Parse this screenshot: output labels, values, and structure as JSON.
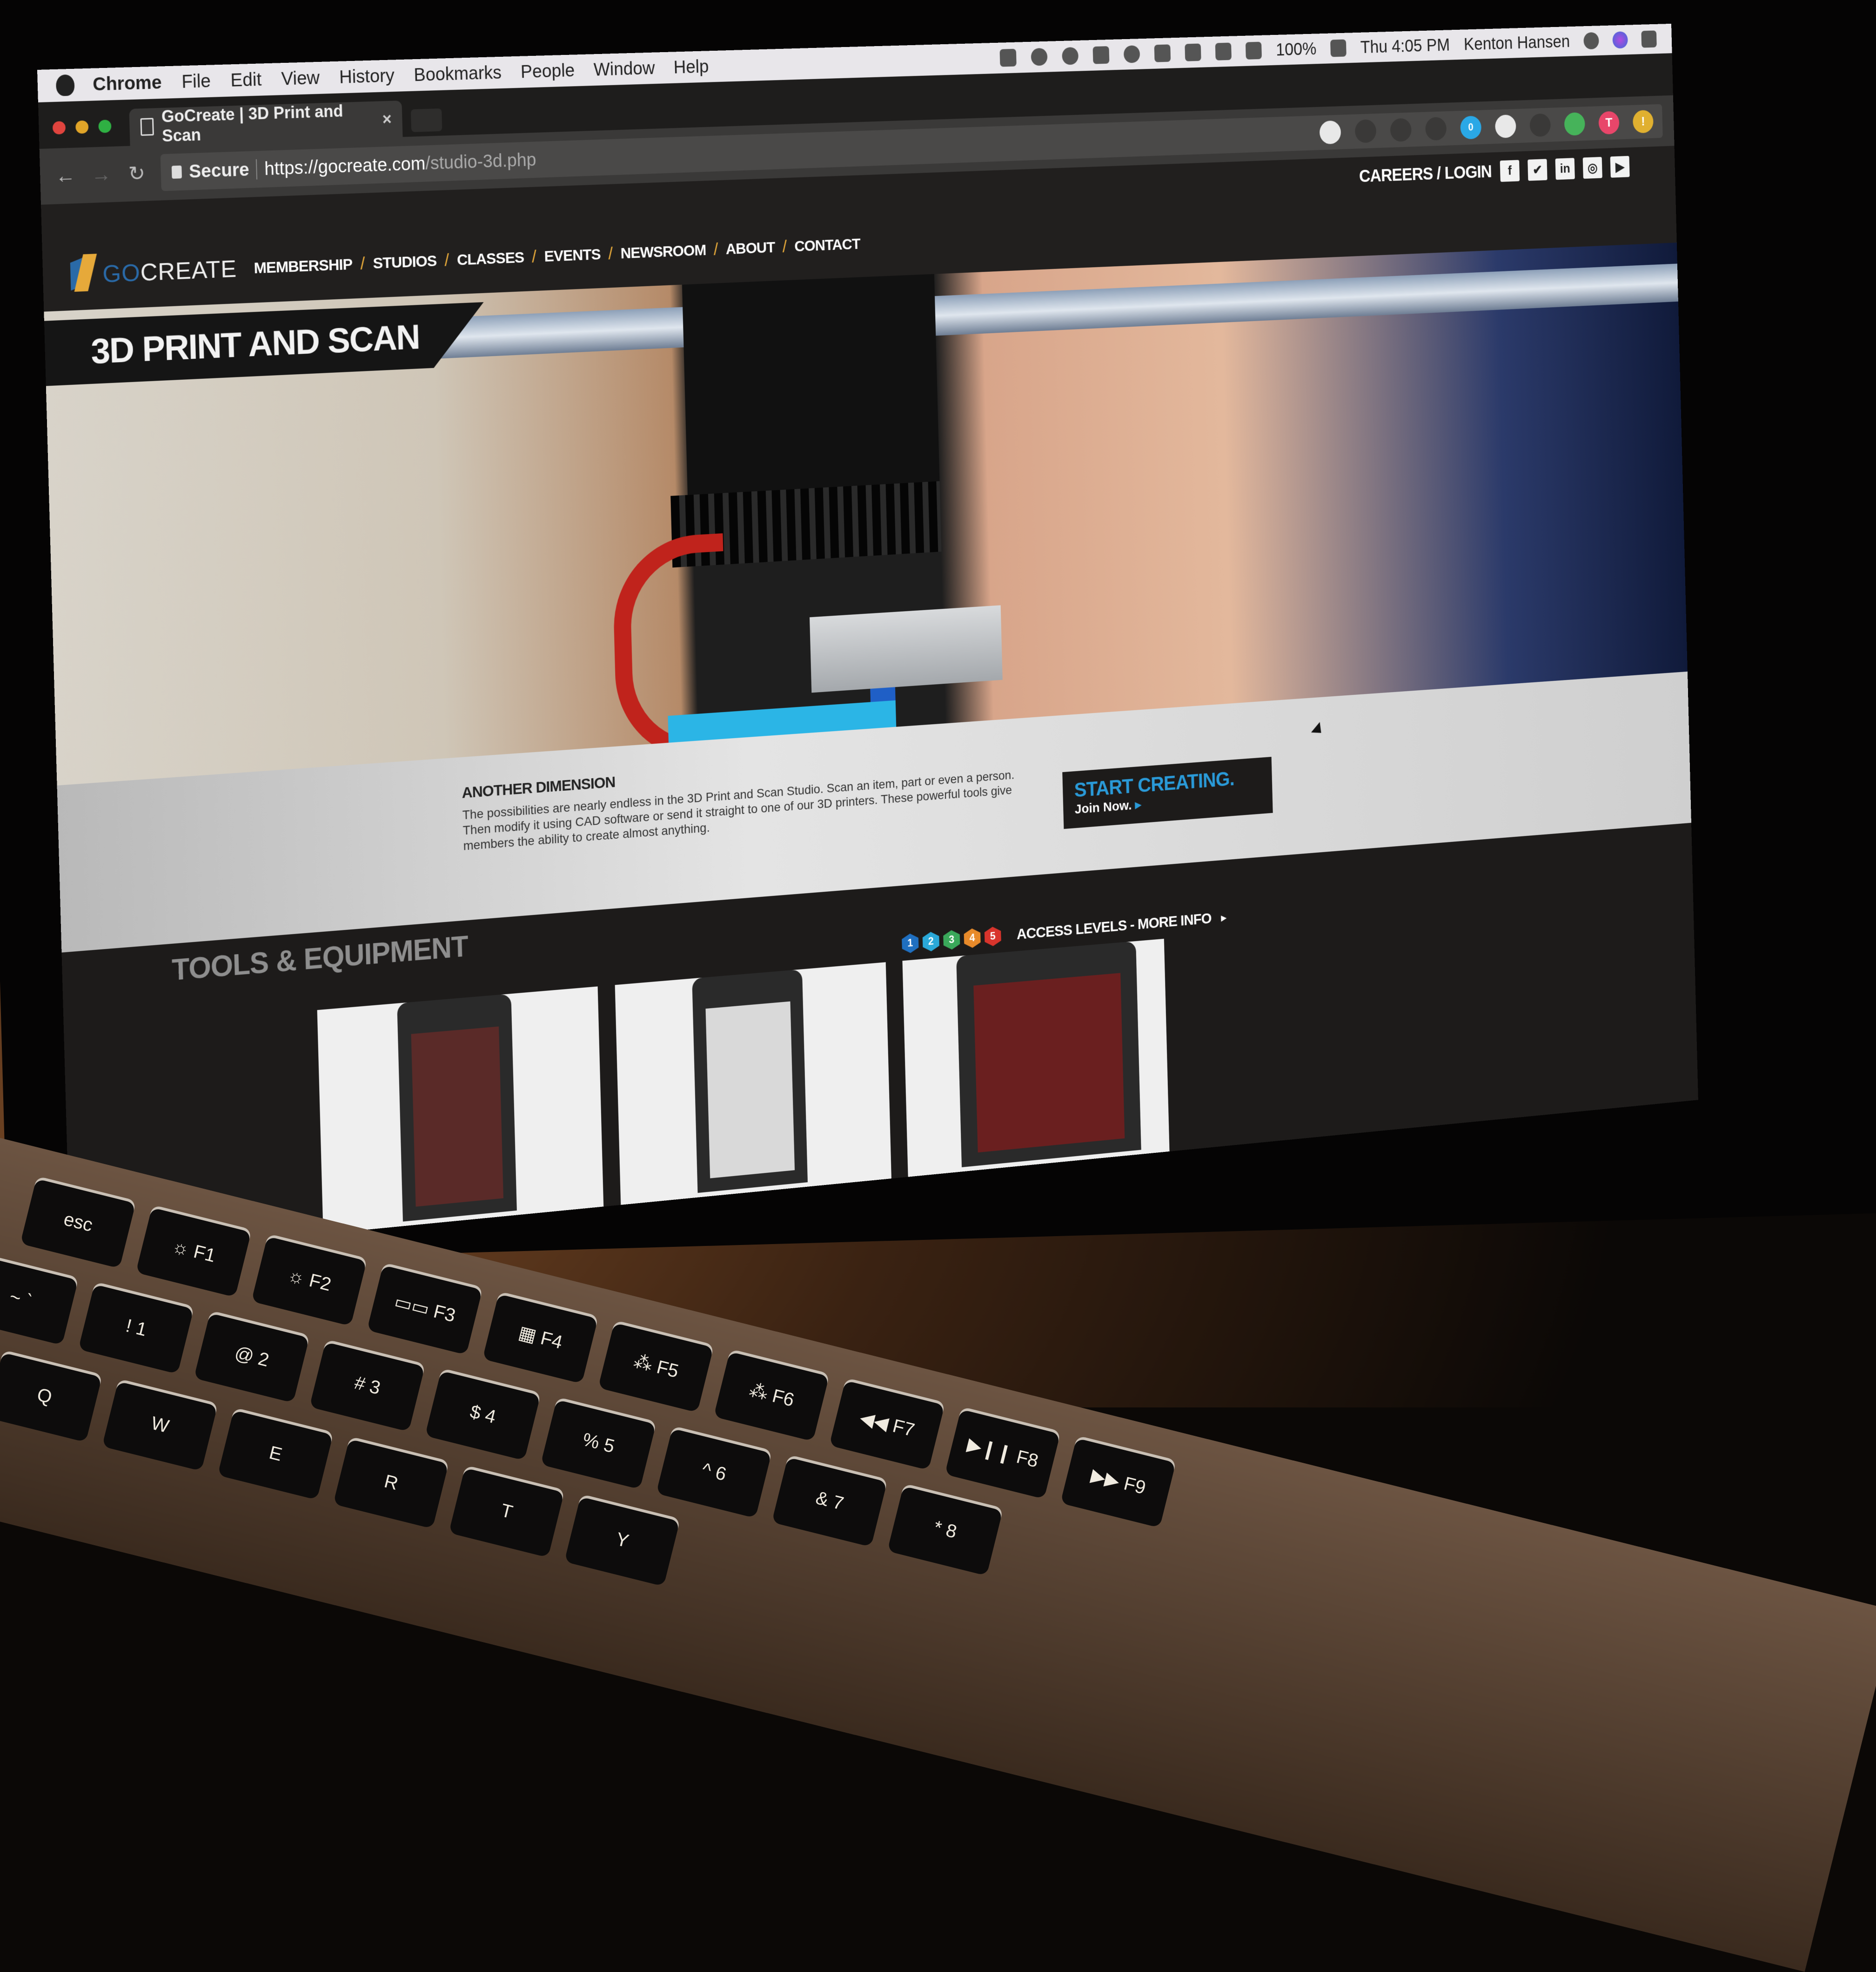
{
  "menubar": {
    "app": "Chrome",
    "items": [
      "File",
      "Edit",
      "View",
      "History",
      "Bookmarks",
      "People",
      "Window",
      "Help"
    ],
    "status_icons": [
      "evernote-icon",
      "creative-cloud-icon",
      "bell-icon",
      "glasses-icon",
      "time-machine-icon",
      "airplay-icon",
      "bluetooth-icon",
      "wifi-icon",
      "volume-icon"
    ],
    "battery": "100%",
    "clock": "Thu 4:05 PM",
    "user": "Kenton Hansen"
  },
  "browser": {
    "tab_title": "GoCreate | 3D Print and Scan",
    "tab_close": "×",
    "secure_label": "Secure",
    "url_scheme_host": "https://gocreate.com",
    "url_path": "/studio-3d.php",
    "extensions": [
      {
        "name": "ghostery-extension-icon",
        "color": "#e8e8e8"
      },
      {
        "name": "zoom-icon",
        "color": "#3a3938"
      },
      {
        "name": "bookmark-star-icon",
        "color": "#3a3938"
      },
      {
        "name": "onepassword-extension-icon",
        "color": "#3a3938"
      },
      {
        "name": "blue-ghost-extension-icon",
        "color": "#2aa8e6",
        "badge": "0"
      },
      {
        "name": "white-square-extension-icon",
        "color": "#e8e8e8"
      },
      {
        "name": "cast-icon",
        "color": "#3a3938"
      },
      {
        "name": "green-shield-extension-icon",
        "color": "#46b35a"
      },
      {
        "name": "pink-t-extension-icon",
        "color": "#e8466a",
        "label": "T"
      },
      {
        "name": "yellow-alert-extension-icon",
        "color": "#e0b030",
        "label": "!"
      }
    ]
  },
  "site": {
    "careers_login": "CAREERS / LOGIN",
    "social": [
      {
        "name": "facebook-icon",
        "glyph": "f"
      },
      {
        "name": "twitter-icon",
        "glyph": "✔"
      },
      {
        "name": "linkedin-icon",
        "glyph": "in"
      },
      {
        "name": "instagram-icon",
        "glyph": "◎"
      },
      {
        "name": "youtube-icon",
        "glyph": "▶"
      }
    ],
    "logo": {
      "go": "GO",
      "create": "CREATE"
    },
    "nav": [
      "MEMBERSHIP",
      "STUDIOS",
      "CLASSES",
      "EVENTS",
      "NEWSROOM",
      "ABOUT",
      "CONTACT"
    ],
    "nav_separator": "/",
    "hero_title": "3D PRINT AND SCAN",
    "intro": {
      "heading": "ANOTHER DIMENSION",
      "body": "The possibilities are nearly endless in the 3D Print and Scan Studio. Scan an item, part or even a person. Then modify it using CAD software or send it straight to one of our 3D printers. These powerful tools give members the ability to create almost anything."
    },
    "cta": {
      "headline": "START CREATING.",
      "sub": "Join Now.",
      "arrow": "▸"
    },
    "tools_heading": "TOOLS & EQUIPMENT",
    "access_levels": {
      "levels": [
        {
          "n": "1",
          "color": "#1f6fc0"
        },
        {
          "n": "2",
          "color": "#2aa8d8"
        },
        {
          "n": "3",
          "color": "#3aa85a"
        },
        {
          "n": "4",
          "color": "#e88a2a"
        },
        {
          "n": "5",
          "color": "#d8342c"
        }
      ],
      "label": "ACCESS LEVELS - MORE INFO",
      "arrow": "▸"
    },
    "equipment_cards": [
      {
        "name": "makerbot-replicator-mini-card"
      },
      {
        "name": "makerbot-replicator-z18-card"
      },
      {
        "name": "makerbot-replicator-card"
      }
    ]
  },
  "keyboard": {
    "function_row": [
      "esc",
      "☼ F1",
      "☼ F2",
      "▭▭ F3",
      "▦ F4",
      "⁂ F5",
      "⁂ F6",
      "◀◀ F7",
      "▶❙❙ F8",
      "▶▶ F9"
    ],
    "number_row": [
      "~ `",
      "! 1",
      "@ 2",
      "# 3",
      "$ 4",
      "% 5",
      "^ 6",
      "& 7",
      "* 8"
    ],
    "letter_row": [
      "Q",
      "W",
      "E",
      "R",
      "T",
      "Y"
    ]
  },
  "colors": {
    "accent_blue": "#2a9ad8",
    "accent_yellow": "#e6a93a",
    "traffic_red": "#e0443e",
    "traffic_yellow": "#e0a428",
    "traffic_green": "#2fb043"
  }
}
